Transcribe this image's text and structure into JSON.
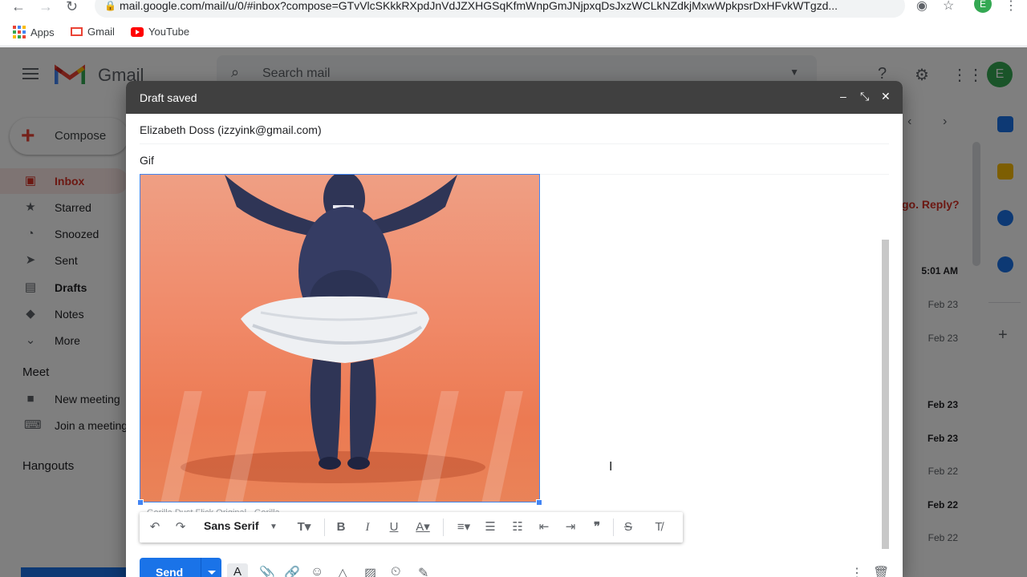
{
  "browser": {
    "url": "mail.google.com/mail/u/0/#inbox?compose=GTvVlcSKkkRXpdJnVdJZXHGSqKfmWnpGmJNjpxqDsJxzWCLkNZdkjMxwWpkpsrDxHFvkWTgzd...",
    "profile_initial": "E",
    "bookmarks": [
      "Apps",
      "Gmail",
      "YouTube"
    ]
  },
  "gmail": {
    "logo_text": "Gmail",
    "search_placeholder": "Search mail",
    "avatar_initial": "E",
    "compose_label": "Compose",
    "nav": [
      "Inbox",
      "Starred",
      "Snoozed",
      "Sent",
      "Drafts",
      "Notes",
      "More"
    ],
    "meet": {
      "heading": "Meet",
      "items": [
        "New meeting",
        "Join a meeting"
      ]
    },
    "hangouts_heading": "Hangouts",
    "reply_peek": "go. Reply?",
    "dates": [
      "5:01 AM",
      "Feb 23",
      "Feb 23",
      "Feb 23",
      "Feb 23",
      "Feb 22",
      "Feb 22",
      "Feb 22"
    ],
    "accent": "#d93025"
  },
  "compose": {
    "title": "Draft saved",
    "to": "Elizabeth Doss (izzyink@gmail.com)",
    "subject": "Gif",
    "caption_peek": "Gorilla Dust Flick Original - Gorilla...",
    "font_name": "Sans Serif",
    "send_label": "Send",
    "format_icon": "A",
    "send_color": "#1a73e8"
  }
}
